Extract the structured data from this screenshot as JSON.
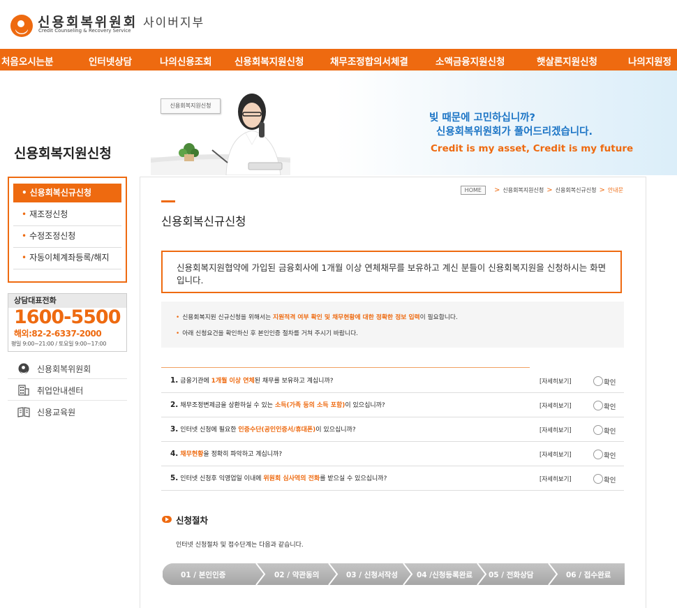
{
  "header": {
    "logo_ko": "신용회복위원회",
    "logo_en": "Credit Counseling & Recovery Service",
    "logo_sub": "사이버지부"
  },
  "nav": [
    {
      "label": "처음오시는분"
    },
    {
      "label": "인터넷상담"
    },
    {
      "label": "나의신용조회"
    },
    {
      "label": "신용회복지원신청"
    },
    {
      "label": "채무조정합의서체결"
    },
    {
      "label": "소액금융지원신청"
    },
    {
      "label": "햇살론지원신청"
    },
    {
      "label": "나의지원정"
    }
  ],
  "banner": {
    "section_title": "신용회복지원신청",
    "tag": "신용회복지원신청",
    "line1": "빚 때문에 고민하십니까?",
    "line2": "신용회복위원회가 풀어드리겠습니다.",
    "line3": "Credit is my asset, Credit is my future"
  },
  "sidebar": {
    "items": [
      {
        "label": "신용회복신규신청",
        "active": true
      },
      {
        "label": "재조정신청",
        "active": false
      },
      {
        "label": "수정조정신청",
        "active": false
      },
      {
        "label": "자동이체계좌등록/해지",
        "active": false
      }
    ],
    "hotline": {
      "title": "상담대표전화",
      "number": "1600-5500",
      "intl": "해외:82-2-6337-2000",
      "hours": "평일 9:00~21:00 / 토요일 9:00~17:00"
    },
    "links": [
      {
        "label": "신용회복위원회",
        "icon": "ccrs-logo-icon"
      },
      {
        "label": "취업안내센터",
        "icon": "building-icon"
      },
      {
        "label": "신용교육원",
        "icon": "book-icon"
      }
    ]
  },
  "breadcrumb": {
    "home": "HOME",
    "items": [
      "신용회복지원신청",
      "신용회복신규신청"
    ],
    "current": "안내문"
  },
  "page": {
    "title": "신용회복신규신청",
    "intro": "신용회복지원협약에 가입된 금융회사에 1개월 이상 연체채무를 보유하고 계신 분들이 신용회복지원을 신청하시는 화면 입니다."
  },
  "notice": {
    "bullet": "•",
    "row1_a": "신용회복지원 신규신청을 위해서는 ",
    "row1_hl": "지원적격 여부 확인 및 채무현황에 대한 정확한 정보 입력",
    "row1_b": "이 필요합니다.",
    "row2": "아래 신청요건을 확인하신 후 본인인증 절차를 거쳐 주시기 바랍니다."
  },
  "questions": {
    "detail_label": "[자세히보기]",
    "confirm_label": "확인",
    "items": [
      {
        "num": "1.",
        "pre": "금융기관에 ",
        "hl": "1개월 이상 연체",
        "post": "된 채무를 보유하고 계십니까?"
      },
      {
        "num": "2.",
        "pre": "채무조정변제금을 상환하실 수 있는 ",
        "hl": "소득(가족 등의 소득 포함)",
        "post": "이 있으십니까?"
      },
      {
        "num": "3.",
        "pre": "인터넷 신청에 필요한 ",
        "hl": "인증수단(공인인증서/휴대폰)",
        "post": "이 있으십니까?"
      },
      {
        "num": "4.",
        "pre": "",
        "hl": "채무현황",
        "post": "을 정확히 파악하고 계십니까?"
      },
      {
        "num": "5.",
        "pre": "인터넷 신청후 익영업일 이내에 ",
        "hl": "위원회 심사역의 전화",
        "post": "를 받으실 수 있으십니까?"
      }
    ]
  },
  "process": {
    "title": "신청절차",
    "desc": "인터넷 신청절차 및 접수단계는 다음과 같습니다.",
    "steps": [
      "01 / 본인인증",
      "02 / 약관동의",
      "03 / 신청서작성",
      "04 /신청등록완료",
      "05 / 전화상담",
      "06 / 접수완료"
    ]
  },
  "colors": {
    "accent": "#ee6a10",
    "blue": "#1b74c5",
    "step_bg": "#b5b5b5"
  }
}
